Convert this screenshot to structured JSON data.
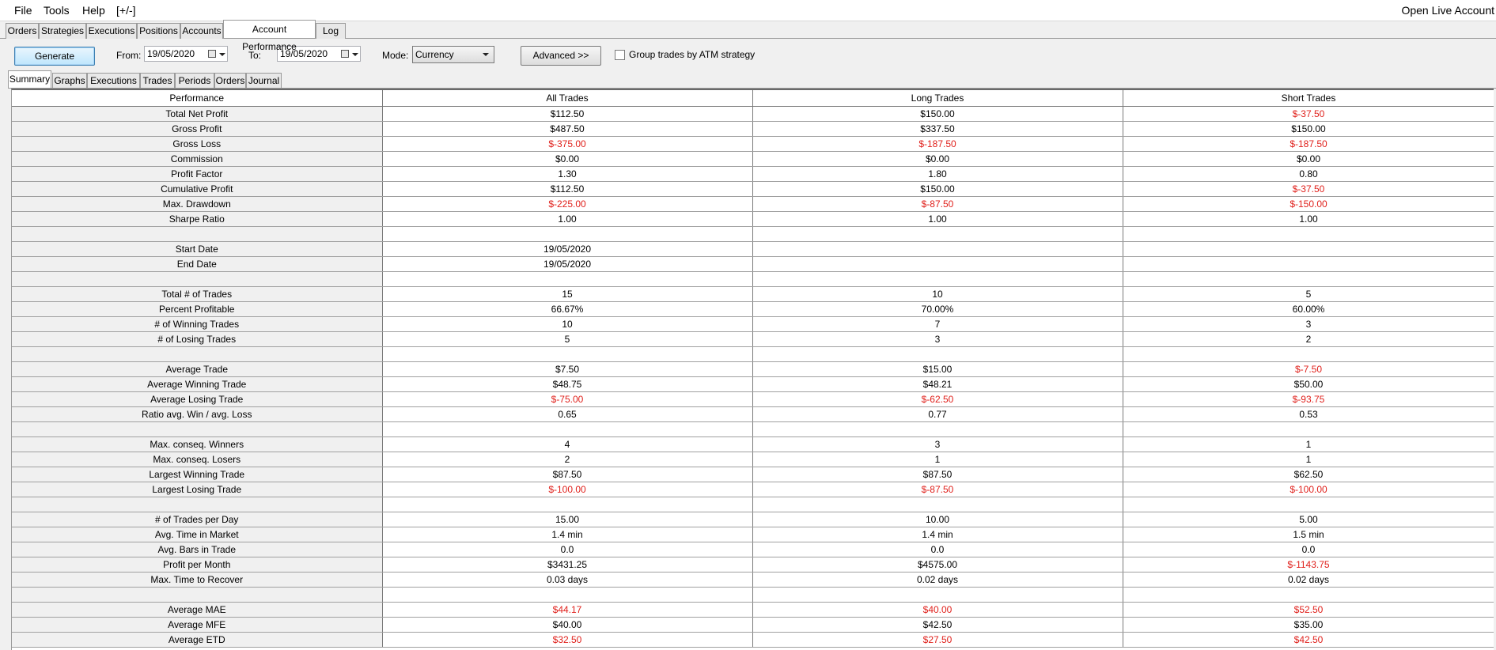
{
  "menu": {
    "file": "File",
    "tools": "Tools",
    "help": "Help",
    "toggle": "[+/-]",
    "open_live": "Open Live Account"
  },
  "main_tabs": [
    "Orders",
    "Strategies",
    "Executions",
    "Positions",
    "Accounts",
    "Account Performance",
    "Log"
  ],
  "toolbar": {
    "generate": "Generate",
    "from_label": "From:",
    "from_value": "19/05/2020",
    "to_label": "To:",
    "to_value": "19/05/2020",
    "mode_label": "Mode:",
    "mode_value": "Currency",
    "advanced": "Advanced >>",
    "group_atm": "Group trades by ATM strategy"
  },
  "sub_tabs": [
    "Summary",
    "Graphs",
    "Executions",
    "Trades",
    "Periods",
    "Orders",
    "Journal"
  ],
  "table": {
    "headers": [
      "Performance",
      "All Trades",
      "Long Trades",
      "Short Trades"
    ],
    "rows": [
      [
        "Total Net Profit",
        "$112.50",
        "$150.00",
        "$-37.50"
      ],
      [
        "Gross Profit",
        "$487.50",
        "$337.50",
        "$150.00"
      ],
      [
        "Gross Loss",
        "$-375.00",
        "$-187.50",
        "$-187.50"
      ],
      [
        "Commission",
        "$0.00",
        "$0.00",
        "$0.00"
      ],
      [
        "Profit Factor",
        "1.30",
        "1.80",
        "0.80"
      ],
      [
        "Cumulative Profit",
        "$112.50",
        "$150.00",
        "$-37.50"
      ],
      [
        "Max. Drawdown",
        "$-225.00",
        "$-87.50",
        "$-150.00"
      ],
      [
        "Sharpe Ratio",
        "1.00",
        "1.00",
        "1.00"
      ],
      [
        "",
        "",
        "",
        ""
      ],
      [
        "Start Date",
        "19/05/2020",
        "",
        ""
      ],
      [
        "End Date",
        "19/05/2020",
        "",
        ""
      ],
      [
        "",
        "",
        "",
        ""
      ],
      [
        "Total # of Trades",
        "15",
        "10",
        "5"
      ],
      [
        "Percent Profitable",
        "66.67%",
        "70.00%",
        "60.00%"
      ],
      [
        "# of Winning Trades",
        "10",
        "7",
        "3"
      ],
      [
        "# of Losing Trades",
        "5",
        "3",
        "2"
      ],
      [
        "",
        "",
        "",
        ""
      ],
      [
        "Average Trade",
        "$7.50",
        "$15.00",
        "$-7.50"
      ],
      [
        "Average Winning Trade",
        "$48.75",
        "$48.21",
        "$50.00"
      ],
      [
        "Average Losing Trade",
        "$-75.00",
        "$-62.50",
        "$-93.75"
      ],
      [
        "Ratio avg. Win / avg. Loss",
        "0.65",
        "0.77",
        "0.53"
      ],
      [
        "",
        "",
        "",
        ""
      ],
      [
        "Max. conseq. Winners",
        "4",
        "3",
        "1"
      ],
      [
        "Max. conseq. Losers",
        "2",
        "1",
        "1"
      ],
      [
        "Largest Winning Trade",
        "$87.50",
        "$87.50",
        "$62.50"
      ],
      [
        "Largest Losing Trade",
        "$-100.00",
        "$-87.50",
        "$-100.00"
      ],
      [
        "",
        "",
        "",
        ""
      ],
      [
        "# of Trades per Day",
        "15.00",
        "10.00",
        "5.00"
      ],
      [
        "Avg. Time in Market",
        "1.4 min",
        "1.4 min",
        "1.5 min"
      ],
      [
        "Avg. Bars in Trade",
        "0.0",
        "0.0",
        "0.0"
      ],
      [
        "Profit per Month",
        "$3431.25",
        "$4575.00",
        "$-1143.75"
      ],
      [
        "Max. Time to Recover",
        "0.03 days",
        "0.02 days",
        "0.02 days"
      ],
      [
        "",
        "",
        "",
        ""
      ],
      [
        "Average MAE",
        "$44.17",
        "$40.00",
        "$52.50"
      ],
      [
        "Average MFE",
        "$40.00",
        "$42.50",
        "$35.00"
      ],
      [
        "Average ETD",
        "$32.50",
        "$27.50",
        "$42.50"
      ]
    ],
    "negative_cells": [
      [
        0,
        3
      ],
      [
        2,
        1
      ],
      [
        2,
        2
      ],
      [
        2,
        3
      ],
      [
        5,
        3
      ],
      [
        6,
        1
      ],
      [
        6,
        2
      ],
      [
        6,
        3
      ],
      [
        17,
        3
      ],
      [
        19,
        1
      ],
      [
        19,
        2
      ],
      [
        19,
        3
      ],
      [
        25,
        1
      ],
      [
        25,
        2
      ],
      [
        25,
        3
      ],
      [
        30,
        3
      ],
      [
        33,
        1
      ],
      [
        33,
        2
      ],
      [
        33,
        3
      ],
      [
        35,
        1
      ],
      [
        35,
        2
      ],
      [
        35,
        3
      ]
    ],
    "negative_color": "#e0201b"
  }
}
